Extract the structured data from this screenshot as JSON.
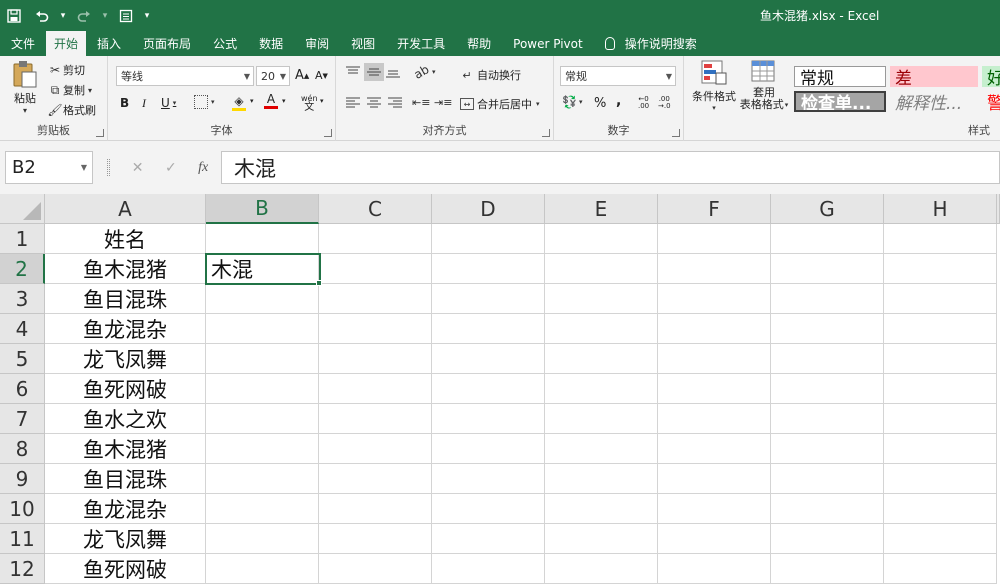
{
  "app": {
    "title": "鱼木混猪.xlsx  -  Excel",
    "accent": "#217346"
  },
  "quick_access": [
    "save-icon",
    "undo-icon",
    "redo-icon",
    "customize-icon"
  ],
  "tabs": [
    {
      "label": "文件",
      "active": false
    },
    {
      "label": "开始",
      "active": true
    },
    {
      "label": "插入",
      "active": false
    },
    {
      "label": "页面布局",
      "active": false
    },
    {
      "label": "公式",
      "active": false
    },
    {
      "label": "数据",
      "active": false
    },
    {
      "label": "审阅",
      "active": false
    },
    {
      "label": "视图",
      "active": false
    },
    {
      "label": "开发工具",
      "active": false
    },
    {
      "label": "帮助",
      "active": false
    },
    {
      "label": "Power Pivot",
      "active": false
    },
    {
      "label": "操作说明搜索",
      "active": false
    }
  ],
  "ribbon": {
    "clipboard": {
      "label": "剪贴板",
      "paste": "粘贴",
      "cut": "剪切",
      "copy": "复制",
      "format_painter": "格式刷"
    },
    "font": {
      "label": "字体",
      "name": "等线",
      "size": "20",
      "bold": "B",
      "italic": "I",
      "underline": "U",
      "grow": "A",
      "shrink": "A",
      "phonetic": "wén"
    },
    "alignment": {
      "label": "对齐方式",
      "wrap": "自动换行",
      "merge": "合并后居中"
    },
    "number": {
      "label": "数字",
      "format": "常规",
      "percent": "%",
      "comma": ","
    },
    "styles": {
      "label": "样式",
      "conditional": "条件格式",
      "table_line1": "套用",
      "table_line2": "表格格式",
      "normal": "常规",
      "bad": "差",
      "good": "好",
      "check": "检查单...",
      "explanatory": "解释性...",
      "warning": "警"
    }
  },
  "formula_bar": {
    "name_box": "B2",
    "value": "木混",
    "cancel": "✕",
    "enter": "✓",
    "fx": "fx"
  },
  "columns": [
    "A",
    "B",
    "C",
    "D",
    "E",
    "F",
    "G",
    "H"
  ],
  "rows": [
    {
      "num": "1",
      "a": "姓名",
      "b": ""
    },
    {
      "num": "2",
      "a": "鱼木混猪",
      "b": "木混"
    },
    {
      "num": "3",
      "a": "鱼目混珠",
      "b": ""
    },
    {
      "num": "4",
      "a": "鱼龙混杂",
      "b": ""
    },
    {
      "num": "5",
      "a": "龙飞凤舞",
      "b": ""
    },
    {
      "num": "6",
      "a": "鱼死网破",
      "b": ""
    },
    {
      "num": "7",
      "a": "鱼水之欢",
      "b": ""
    },
    {
      "num": "8",
      "a": "鱼木混猪",
      "b": ""
    },
    {
      "num": "9",
      "a": "鱼目混珠",
      "b": ""
    },
    {
      "num": "10",
      "a": "鱼龙混杂",
      "b": ""
    },
    {
      "num": "11",
      "a": "龙飞凤舞",
      "b": ""
    },
    {
      "num": "12",
      "a": "鱼死网破",
      "b": ""
    }
  ],
  "selection": {
    "cell": "B2",
    "column": "B",
    "row": "2"
  }
}
